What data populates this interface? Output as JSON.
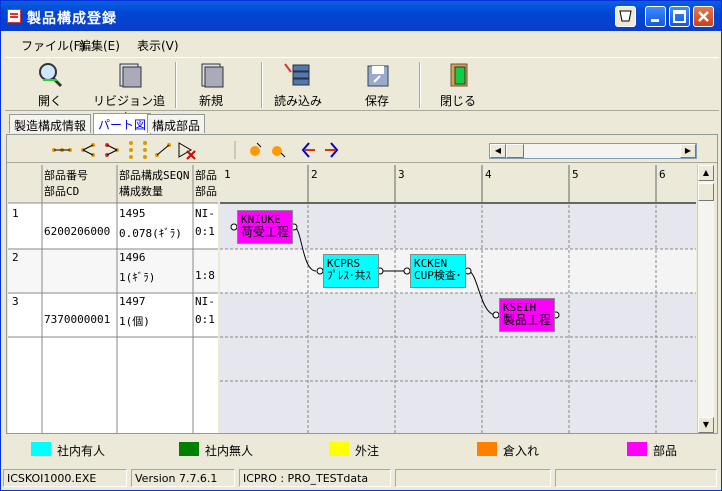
{
  "window": {
    "title": "製品構成登録"
  },
  "menu": [
    "ファイル(F)",
    "編集(E)",
    "表示(V)"
  ],
  "toolbar": {
    "open": "開く",
    "add_revision": "リビジョン追加",
    "new": "新規",
    "load": "読み込み",
    "save": "保存",
    "close": "閉じる"
  },
  "tabs": [
    "製造構成情報",
    "パート図",
    "構成部品"
  ],
  "grid": {
    "headers": {
      "col1_line1": "部品番号",
      "col1_line2": "部品CD",
      "col2_line1": "部品構成SEQN",
      "col2_line2": "構成数量",
      "col3_line1": "部品",
      "col3_line2": "部品"
    },
    "rows": [
      {
        "no": "1",
        "cd": "6200206000",
        "seq": "1495",
        "qty": "0.078(ｷﾞﾗ)",
        "c3a": "NI-",
        "c3b": "0:1"
      },
      {
        "no": "2",
        "cd": "",
        "seq": "1496",
        "qty": "1(ｷﾞﾗ)",
        "c3a": "",
        "c3b": "1:8"
      },
      {
        "no": "3",
        "cd": "7370000001",
        "seq": "1497",
        "qty": "1(個)",
        "c3a": "NI-",
        "c3b": "0:1"
      }
    ]
  },
  "gantt": {
    "columns": [
      "1",
      "2",
      "3",
      "4",
      "5",
      "6"
    ],
    "nodes": [
      {
        "code": "KNIUKE",
        "name": "荷受工程",
        "color": "#ff00ff"
      },
      {
        "code": "KCPRS",
        "name": "ﾌﾟﾚｽ･共ｽ",
        "color": "#00ffff"
      },
      {
        "code": "KCKEN",
        "name": "CUP検査･",
        "color": "#00ffff"
      },
      {
        "code": "KSEIH",
        "name": "製品工程",
        "color": "#ff00ff"
      }
    ]
  },
  "legend": [
    {
      "label": "社内有人",
      "color": "#00ffff"
    },
    {
      "label": "社内無人",
      "color": "#008000"
    },
    {
      "label": "外注",
      "color": "#ffff00"
    },
    {
      "label": "倉入れ",
      "color": "#ff8000"
    },
    {
      "label": "部品",
      "color": "#ff00ff"
    }
  ],
  "status": {
    "exe": "ICSKOI1000.EXE",
    "version": "Version 7.7.6.1",
    "db": "ICPRO : PRO_TESTdata"
  }
}
